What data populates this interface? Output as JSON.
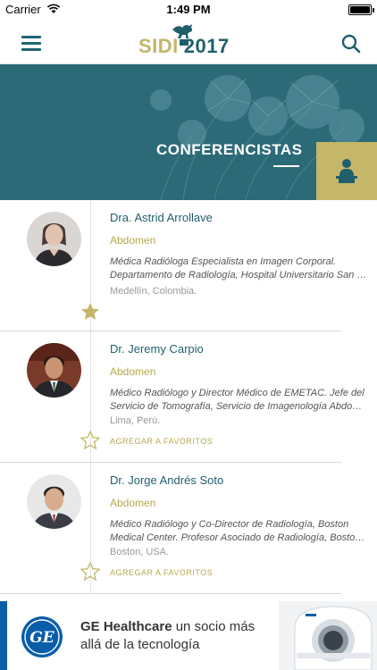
{
  "status_bar": {
    "carrier": "Carrier",
    "time": "1:49 PM"
  },
  "header": {
    "logo_sidi": "SIDI",
    "logo_year": "2017"
  },
  "banner": {
    "title": "CONFERENCISTAS"
  },
  "speakers": [
    {
      "name": "Dra. Astrid Arrollave",
      "specialty": "Abdomen",
      "bio_line1": "Médica Radióloga Especialista en Imagen Corporal.",
      "bio_line2": "Departamento de Radiología, Hospital Universitario San Vicente Fundación",
      "location": "Medellín, Colombia.",
      "favorite": true,
      "favorite_label": ""
    },
    {
      "name": "Dr. Jeremy Carpio",
      "specialty": "Abdomen",
      "bio_line1": "Médico Radiólogo y Director Médico de EMETAC. Jefe del",
      "bio_line2": "Servicio de Tomografía, Servicio de Imagenología Abdominal",
      "location": "Lima, Perú.",
      "favorite": false,
      "favorite_label": "AGREGAR A FAVORITOS"
    },
    {
      "name": "Dr. Jorge Andrés Soto",
      "specialty": "Abdomen",
      "bio_line1": "Médico Radiólogo y Co-Director de Radiología, Boston",
      "bio_line2": "Medical Center. Profesor Asociado de Radiología, Boston University",
      "location": "Boston, USA.",
      "favorite": false,
      "favorite_label": "AGREGAR A FAVORITOS"
    }
  ],
  "ad": {
    "brand": "GE Healthcare",
    "line1_rest": " un socio más",
    "line2": "allá de la tecnología"
  },
  "colors": {
    "teal": "#2c6a78",
    "gold": "#c4b769",
    "dark_teal": "#1f5f6b"
  }
}
